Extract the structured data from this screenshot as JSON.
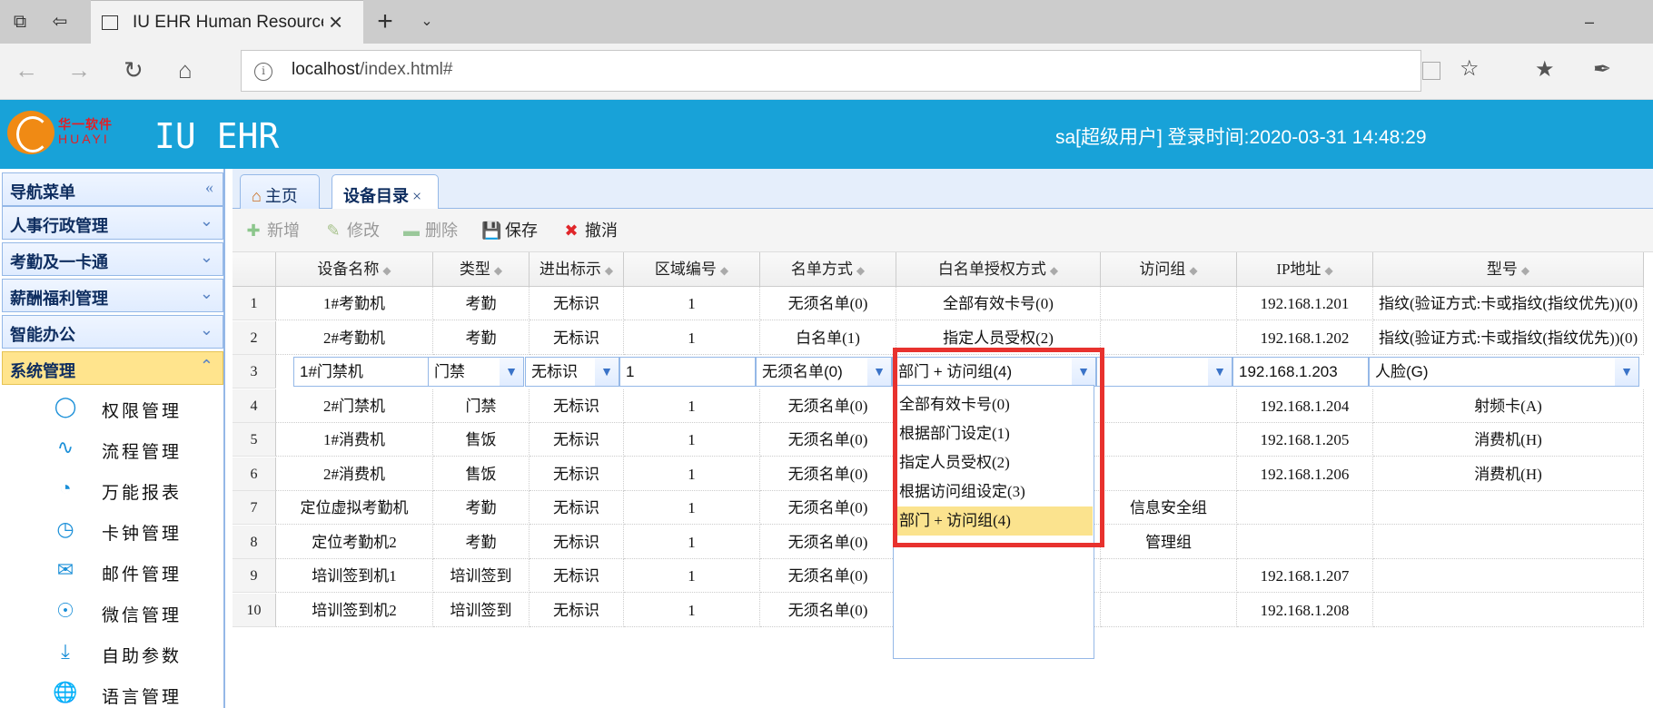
{
  "browser": {
    "tab_title": "IU EHR Human Resource",
    "url_host": "localhost",
    "url_path": "/index.html#"
  },
  "header": {
    "logo_cn": "华一软件",
    "logo_en": "HUAYI",
    "title": "IU EHR",
    "user_info": "sa[超级用户] 登录时间:2020-03-31 14:48:29"
  },
  "sidebar": {
    "title": "导航菜单",
    "menus": [
      "人事行政管理",
      "考勤及一卡通",
      "薪酬福利管理",
      "智能办公",
      "系统管理"
    ],
    "sub_items": [
      {
        "label": "权限管理",
        "icon": "bulb-icon"
      },
      {
        "label": "流程管理",
        "icon": "pulse-icon"
      },
      {
        "label": "万能报表",
        "icon": "pie-icon"
      },
      {
        "label": "卡钟管理",
        "icon": "alarm-icon"
      },
      {
        "label": "邮件管理",
        "icon": "mail-icon"
      },
      {
        "label": "微信管理",
        "icon": "rss-icon"
      },
      {
        "label": "自助参数",
        "icon": "download-icon"
      },
      {
        "label": "语言管理",
        "icon": "globe-icon"
      }
    ]
  },
  "tabs": {
    "home": "主页",
    "current": "设备目录"
  },
  "toolbar": {
    "add": "新增",
    "edit": "修改",
    "delete": "删除",
    "save": "保存",
    "cancel": "撤消"
  },
  "grid": {
    "columns": [
      "设备名称",
      "类型",
      "进出标示",
      "区域编号",
      "名单方式",
      "白名单授权方式",
      "访问组",
      "IP地址",
      "型号"
    ],
    "rows": [
      [
        "1",
        "1#考勤机",
        "考勤",
        "无标识",
        "1",
        "无须名单(0)",
        "全部有效卡号(0)",
        "",
        "192.168.1.201",
        "指纹(验证方式:卡或指纹(指纹优先))(0)"
      ],
      [
        "2",
        "2#考勤机",
        "考勤",
        "无标识",
        "1",
        "白名单(1)",
        "指定人员受权(2)",
        "",
        "192.168.1.202",
        "指纹(验证方式:卡或指纹(指纹优先))(0)"
      ],
      [
        "3",
        "1#门禁机",
        "门禁",
        "无标识",
        "1",
        "无须名单(0)",
        "部门 + 访问组(4)",
        "",
        "192.168.1.203",
        "人脸(G)"
      ],
      [
        "4",
        "2#门禁机",
        "门禁",
        "无标识",
        "1",
        "无须名单(0)",
        "",
        "",
        "192.168.1.204",
        "射频卡(A)"
      ],
      [
        "5",
        "1#消费机",
        "售饭",
        "无标识",
        "1",
        "无须名单(0)",
        "",
        "",
        "192.168.1.205",
        "消费机(H)"
      ],
      [
        "6",
        "2#消费机",
        "售饭",
        "无标识",
        "1",
        "无须名单(0)",
        "",
        "",
        "192.168.1.206",
        "消费机(H)"
      ],
      [
        "7",
        "定位虚拟考勤机",
        "考勤",
        "无标识",
        "1",
        "无须名单(0)",
        "",
        "信息安全组",
        "",
        ""
      ],
      [
        "8",
        "定位考勤机2",
        "考勤",
        "无标识",
        "1",
        "无须名单(0)",
        "",
        "管理组",
        "",
        ""
      ],
      [
        "9",
        "培训签到机1",
        "培训签到",
        "无标识",
        "1",
        "无须名单(0)",
        "",
        "",
        "192.168.1.207",
        ""
      ],
      [
        "10",
        "培训签到机2",
        "培训签到",
        "无标识",
        "1",
        "无须名单(0)",
        "",
        "",
        "192.168.1.208",
        ""
      ]
    ]
  },
  "dropdown": {
    "options": [
      "全部有效卡号(0)",
      "根据部门设定(1)",
      "指定人员受权(2)",
      "根据访问组设定(3)",
      "部门 + 访问组(4)"
    ],
    "selected_index": 4
  },
  "colors": {
    "header_bg": "#18a2d8",
    "highlight": "#fbe38e",
    "red_frame": "#e8322e",
    "active_menu": "#ffe48d"
  }
}
